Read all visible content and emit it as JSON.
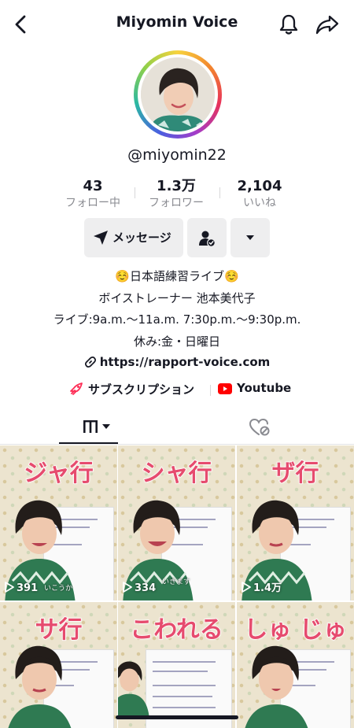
{
  "header": {
    "title": "Miyomin Voice",
    "back_icon": "chevron-left-icon",
    "bell_icon": "bell-icon",
    "share_icon": "share-arrow-icon"
  },
  "profile": {
    "username": "@miyomin22"
  },
  "stats": [
    {
      "value": "43",
      "label": "フォロー中"
    },
    {
      "value": "1.3万",
      "label": "フォロワー"
    },
    {
      "value": "2,104",
      "label": "いいね"
    }
  ],
  "actions": {
    "message_label": "メッセージ",
    "friend_icon": "person-check-icon",
    "more_icon": "caret-down-icon"
  },
  "bio": {
    "lines": [
      "☺️日本語練習ライブ☺️",
      "ボイストレーナー 池本美代子",
      "ライブ:9a.m.〜11a.m.  7:30p.m.〜9:30p.m.",
      "休み:金・日曜日"
    ],
    "link": "https://rapport-voice.com",
    "subscription_label": "サブスクリプション",
    "youtube_label": "Youtube"
  },
  "tabs": {
    "videos_icon": "grid-icon",
    "liked_icon": "liked-heart-icon"
  },
  "colors": {
    "accent": "#fe2c55",
    "caption": "#e64b6e",
    "text": "#161823",
    "muted": "#8a8b91"
  },
  "videos": [
    {
      "caption": "ジャ行",
      "views": "391",
      "overlay": "いこうか"
    },
    {
      "caption": "シャ行",
      "views": "334",
      "overlay": "いきます"
    },
    {
      "caption": "ザ行",
      "views": "1.4万",
      "overlay": ""
    },
    {
      "caption": "サ行",
      "views": "",
      "overlay": ""
    },
    {
      "caption": "こわれる",
      "views": "",
      "overlay": ""
    },
    {
      "caption": "しゅ  じゅ",
      "views": "",
      "overlay": ""
    }
  ]
}
